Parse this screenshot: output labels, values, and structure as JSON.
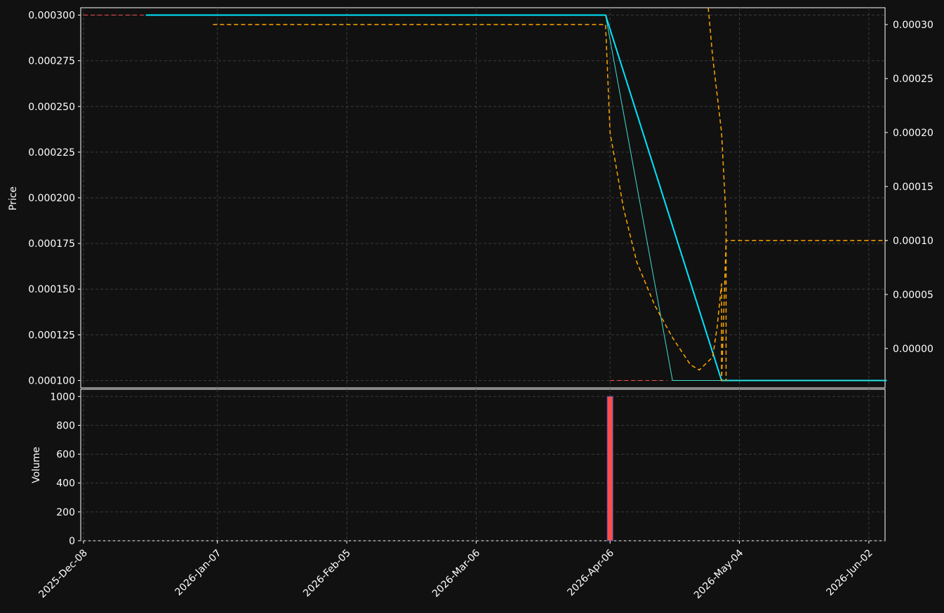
{
  "chart_data": {
    "type": "line",
    "price_panel": {
      "ylabel": "Price",
      "ylim": [
        9.75e-05,
        0.0003025
      ],
      "yticks": [
        "0.000100",
        "0.000125",
        "0.000150",
        "0.000175",
        "0.000200",
        "0.000225",
        "0.000250",
        "0.000275",
        "0.000300"
      ],
      "ytick_values": [
        0.0001,
        0.000125,
        0.00015,
        0.000175,
        0.0002,
        0.000225,
        0.00025,
        0.000275,
        0.0003
      ],
      "right_ylim": [
        -3.65e-05,
        0.0003156
      ],
      "right_yticks": [
        "0.00000",
        "0.00005",
        "0.00010",
        "0.00015",
        "0.00020",
        "0.00025",
        "0.00030"
      ],
      "right_ytick_values": [
        0.0,
        5e-05,
        0.0001,
        0.00015,
        0.0002,
        0.00025,
        0.0003
      ],
      "grid": true,
      "series": [
        {
          "axis": "left",
          "color": "#ff4d4d",
          "style": "dashed",
          "width": 1,
          "points": [
            [
              "2025-12-08",
              0.0003
            ],
            [
              "2025-12-22",
              0.0003
            ]
          ]
        },
        {
          "axis": "left",
          "color": "#ff4d4d",
          "style": "dashed",
          "width": 1,
          "points": [
            [
              "2026-04-05",
              0.0001
            ],
            [
              "2026-04-17",
              0.0001
            ]
          ]
        },
        {
          "axis": "left",
          "color": "#00e5ff",
          "style": "solid",
          "width": 2,
          "points": [
            [
              "2025-12-22",
              0.0003
            ],
            [
              "2026-04-04",
              0.0003
            ],
            [
              "2026-04-30",
              0.0001
            ],
            [
              "2026-06-06",
              0.0001
            ]
          ]
        },
        {
          "axis": "left",
          "color": "#40e0d0",
          "style": "solid",
          "width": 1,
          "points": [
            [
              "2026-04-04",
              0.0003
            ],
            [
              "2026-04-19",
              0.0001
            ],
            [
              "2026-06-06",
              0.0001
            ]
          ]
        },
        {
          "axis": "right",
          "color": "#ffa500",
          "style": "dashed",
          "width": 1.5,
          "points": [
            [
              "2026-01-06",
              0.0003
            ],
            [
              "2026-04-04",
              0.0003
            ],
            [
              "2026-04-05",
              0.0002
            ],
            [
              "2026-04-08",
              0.00013
            ],
            [
              "2026-04-11",
              8e-05
            ],
            [
              "2026-04-15",
              4e-05
            ],
            [
              "2026-04-19",
              1e-05
            ],
            [
              "2026-04-23",
              -1.5e-05
            ],
            [
              "2026-04-25",
              -2e-05
            ],
            [
              "2026-04-28",
              -8e-06
            ],
            [
              "2026-04-29",
              2e-05
            ],
            [
              "2026-04-30",
              6e-05
            ],
            [
              "2026-04-30",
              -3e-05
            ],
            [
              "2026-05-01",
              0.0001
            ],
            [
              "2026-06-06",
              0.0001
            ]
          ]
        },
        {
          "axis": "right",
          "color": "#ffa500",
          "style": "dashed",
          "width": 1.5,
          "points": [
            [
              "2026-04-27",
              0.00032
            ],
            [
              "2026-04-28",
              0.00027
            ],
            [
              "2026-04-30",
              0.0002
            ],
            [
              "2026-05-01",
              0.00012
            ],
            [
              "2026-05-01",
              3e-05
            ],
            [
              "2026-05-01",
              -3e-05
            ]
          ]
        }
      ]
    },
    "volume_panel": {
      "ylabel": "Volume",
      "ylim": [
        0,
        1050
      ],
      "yticks": [
        "0",
        "200",
        "400",
        "600",
        "800",
        "1000"
      ],
      "ytick_values": [
        0,
        200,
        400,
        600,
        800,
        1000
      ],
      "grid": true,
      "bars": [
        {
          "date": "2026-04-05",
          "value": 1000,
          "color": "#ff4d4d"
        }
      ]
    },
    "x_axis": {
      "range": [
        "2025-12-08",
        "2026-06-05"
      ],
      "ticks": [
        "2025-Dec-08",
        "2026-Jan-07",
        "2026-Feb-05",
        "2026-Mar-06",
        "2026-Apr-06",
        "2026-May-04",
        "2026-Jun-02"
      ],
      "tick_dates": [
        "2025-12-08",
        "2026-01-07",
        "2026-02-05",
        "2026-03-06",
        "2026-04-05",
        "2026-05-04",
        "2026-06-02"
      ]
    },
    "colors": {
      "background": "#111111",
      "grid": "#3a3a3a",
      "axes": "#ffffff"
    }
  }
}
